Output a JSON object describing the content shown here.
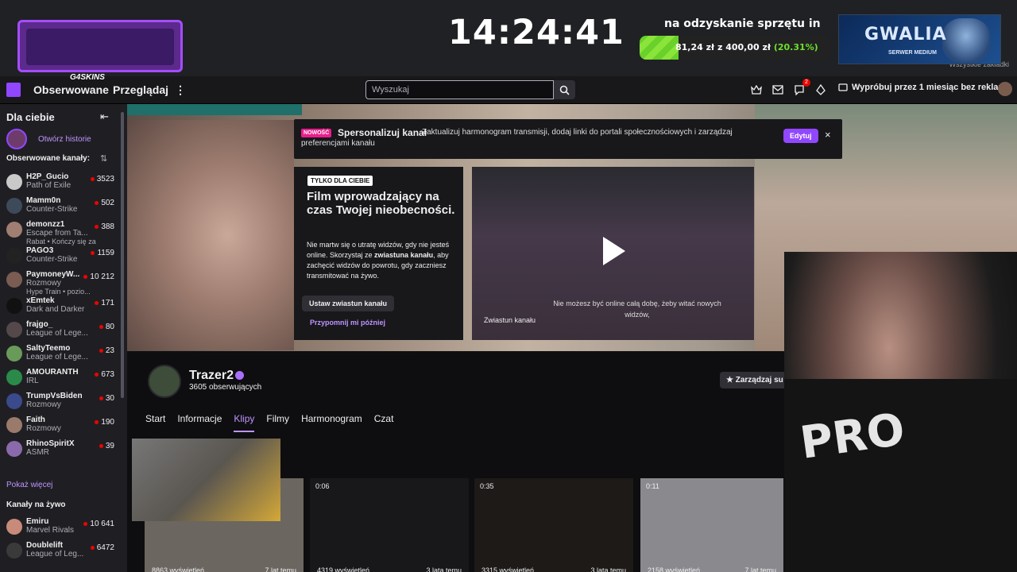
{
  "browser": {
    "bookmarks_label": "Wszystkie zakładki"
  },
  "overlay": {
    "clock": "14:24:41",
    "goal_title": "na odzyskanie sprzętu in",
    "goal_amount": "81,24 zł",
    "goal_of": "z",
    "goal_target": "400,00 zł",
    "goal_percent": "(20.31%)",
    "goal_fraction": 0.2031,
    "g4_brand": "G4SKINS",
    "gwalia_title": "GWALIA",
    "gwalia_sub": "SERWER MEDIUM"
  },
  "nav": {
    "followed": "Obserwowane",
    "browse": "Przeglądaj",
    "more_icon": "more-vertical-icon",
    "search_placeholder": "Wyszukaj",
    "notif_count": "2",
    "promo": "Wypróbuj przez 1 miesiąc bez reklam"
  },
  "sidebar": {
    "title": "Dla ciebie",
    "story": "Otwórz historie",
    "followed_header": "Obserwowane kanały:",
    "show_more": "Pokaż więcej",
    "live_header": "Kanały na żywo",
    "channels": [
      {
        "name": "H2P_Gucio",
        "game": "Path of Exile",
        "viewers": "3523",
        "color": "#c9c9c9"
      },
      {
        "name": "Mamm0n",
        "game": "Counter-Strike",
        "viewers": "502",
        "color": "#3d4a5a"
      },
      {
        "name": "demonzz1",
        "game": "Escape from Ta...",
        "sub": "Rabat • Kończy się za",
        "viewers": "388",
        "color": "#a07e72"
      },
      {
        "name": "PAGO3",
        "game": "Counter-Strike",
        "viewers": "1159",
        "color": "#222"
      },
      {
        "name": "PaymoneyW...",
        "game": "Rozmowy",
        "sub": "Hype Train • pozio...",
        "viewers": "10 212",
        "color": "#7a5c52"
      },
      {
        "name": "xEmtek",
        "game": "Dark and Darker",
        "viewers": "171",
        "color": "#111"
      },
      {
        "name": "frajgo_",
        "game": "League of Lege...",
        "viewers": "80",
        "color": "#55484a"
      },
      {
        "name": "SaltyTeemo",
        "game": "League of Lege...",
        "viewers": "23",
        "color": "#6a9a5a"
      },
      {
        "name": "AMOURANTH",
        "game": "IRL",
        "viewers": "673",
        "color": "#2a8a4a"
      },
      {
        "name": "TrumpVsBiden2...",
        "game": "Rozmowy",
        "viewers": "30",
        "color": "#3a4a8a"
      },
      {
        "name": "Faith",
        "game": "Rozmowy",
        "viewers": "190",
        "color": "#9a7a6a"
      },
      {
        "name": "RhinoSpiritX",
        "game": "ASMR",
        "viewers": "39",
        "color": "#8a6aaa"
      }
    ],
    "live_channels": [
      {
        "name": "Emiru",
        "game": "Marvel Rivals",
        "viewers": "10 641",
        "color": "#c88a7a"
      },
      {
        "name": "Doublelift",
        "game": "League of Leg...",
        "viewers": "6472",
        "color": "#3a3a3a"
      }
    ]
  },
  "notice": {
    "badge": "NOWOŚĆ",
    "title": "Spersonalizuj kanał",
    "text": "Zaktualizuj harmonogram transmisji, dodaj linki do portali społecznościowych i zarządzaj preferencjami kanału",
    "edit": "Edytuj",
    "close": "×"
  },
  "trailer": {
    "tag": "TYLKO DLA CIEBIE",
    "title": "Film wprowadzający na czas Twojej nieobecności.",
    "desc_1": "Nie martw się o utratę widzów, gdy nie jesteś online. Skorzystaj ze ",
    "desc_bold_1": "zwiastuna kanału",
    "desc_2": ", aby zachęcić widzów do powrotu, gdy zaczniesz transmitować na żywo.",
    "set_button": "Ustaw zwiastun kanału",
    "remind": "Przypomnij mi później",
    "video_label": "Zwiastun kanału",
    "subtitle": "Nie możesz być online całą dobę, żeby witać nowych widzów,"
  },
  "channel": {
    "name": "Trazer2",
    "followers": "3605 obserwujących",
    "manage": "Zarządzaj su",
    "tabs": [
      "Start",
      "Informacje",
      "Klipy",
      "Filmy",
      "Harmonogram",
      "Czat"
    ],
    "active_tab": "Klipy"
  },
  "clips": [
    {
      "duration": "",
      "views": "8863 wyświetleń",
      "ago": "7 lat temu"
    },
    {
      "duration": "0:06",
      "views": "4319 wyświetleń",
      "ago": "3 lata temu"
    },
    {
      "duration": "0:35",
      "views": "3315 wyświetleń",
      "ago": "3 lata temu"
    },
    {
      "duration": "0:11",
      "views": "2158 wyświetleń",
      "ago": "7 lat temu"
    }
  ],
  "webcam": {
    "shirt_text": "PRO"
  }
}
